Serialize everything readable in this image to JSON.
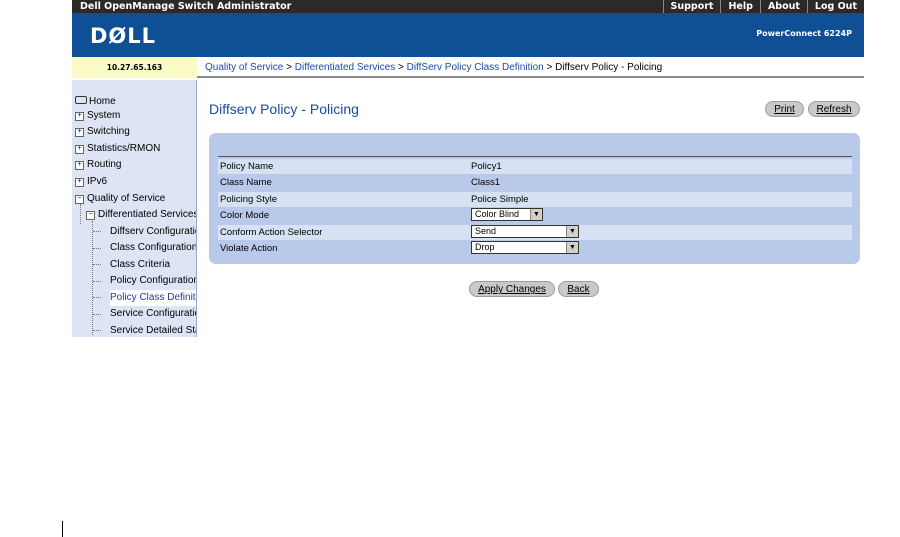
{
  "topbar": {
    "app_title": "Dell OpenManage Switch Administrator",
    "links": [
      "Support",
      "Help",
      "About",
      "Log Out"
    ]
  },
  "banner": {
    "logo": "DØLL",
    "model": "PowerConnect 6224P"
  },
  "ip_address": "10.27.65.163",
  "breadcrumb": {
    "links": [
      "Quality of Service",
      "Differentiated Services",
      "DiffServ Policy Class Definition"
    ],
    "separator": " > ",
    "current": "Diffserv Policy - Policing"
  },
  "nav": {
    "home": "Home",
    "system": "System",
    "switching": "Switching",
    "statistics": "Statistics/RMON",
    "routing": "Routing",
    "ipv6": "IPv6",
    "qos": "Quality of Service",
    "diffserv": "Differentiated Services",
    "diffserv_config": "Diffserv Configuratio",
    "class_config": "Class Configuration",
    "class_criteria": "Class Criteria",
    "policy_config": "Policy Configuration",
    "policy_class_def": "Policy Class Definit",
    "service_config": "Service Configuratio",
    "service_detailed": "Service Detailed Sta",
    "expand_glyph": "+",
    "collapse_glyph": "−"
  },
  "main": {
    "title": "Diffserv Policy - Policing",
    "print_label": "Print",
    "refresh_label": "Refresh",
    "fields": {
      "policy_name": {
        "label": "Policy Name",
        "value": "Policy1"
      },
      "class_name": {
        "label": "Class Name",
        "value": "Class1"
      },
      "policing_style": {
        "label": "Policing Style",
        "value": "Police Simple"
      },
      "color_mode": {
        "label": "Color Mode",
        "value": "Color Blind"
      },
      "conform_action": {
        "label": "Conform Action Selector",
        "value": "Send"
      },
      "violate_action": {
        "label": "Violate Action",
        "value": "Drop"
      }
    },
    "apply_label": "Apply Changes",
    "back_label": "Back",
    "dropdown_glyph": "▼"
  },
  "colors": {
    "banner": "#0e4f96",
    "panel": "#b9c9ea",
    "title": "#1d4a9e",
    "link": "#1a4ea0"
  }
}
